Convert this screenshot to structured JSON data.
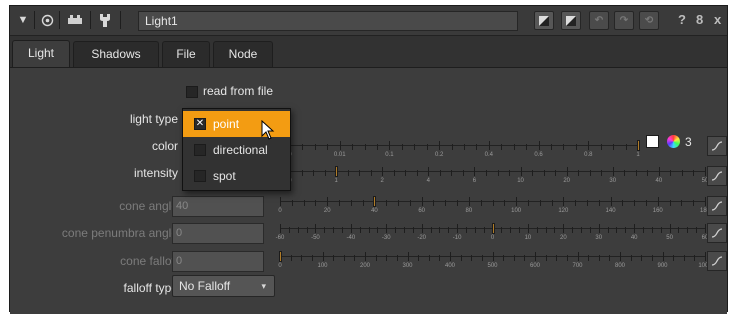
{
  "window": {
    "node_name": "Light1",
    "right_glyphs": [
      "?",
      "8",
      "x"
    ]
  },
  "tabs": [
    {
      "label": "Light",
      "active": true
    },
    {
      "label": "Shadows",
      "active": false
    },
    {
      "label": "File",
      "active": false
    },
    {
      "label": "Node",
      "active": false
    }
  ],
  "read_from_file": {
    "label": "read from file",
    "checked": false
  },
  "light_type": {
    "label": "light type",
    "options": [
      "point",
      "directional",
      "spot"
    ],
    "highlighted": "point"
  },
  "color": {
    "label": "color",
    "channel_count": "3",
    "ticks": [
      "0",
      "0.01",
      "0.1",
      "0.2",
      "0.4",
      "0.6",
      "0.8",
      "1"
    ]
  },
  "intensity": {
    "label": "intensity",
    "ticks": [
      "0",
      "1",
      "2",
      "4",
      "6",
      "10",
      "20",
      "30",
      "40",
      "50"
    ]
  },
  "cone_angle": {
    "label": "cone angle",
    "value": "40",
    "ticks": [
      "0",
      "20",
      "40",
      "60",
      "80",
      "100",
      "120",
      "140",
      "160",
      "180"
    ]
  },
  "cone_penumbra_angle": {
    "label": "cone penumbra angle",
    "value": "0",
    "ticks": [
      "-60",
      "-50",
      "-40",
      "-30",
      "-20",
      "-10",
      "0",
      "10",
      "20",
      "30",
      "40",
      "50",
      "60"
    ]
  },
  "cone_falloff": {
    "label": "cone falloff",
    "value": "0",
    "ticks": [
      "0",
      "100",
      "200",
      "300",
      "400",
      "500",
      "600",
      "700",
      "800",
      "900",
      "1000"
    ]
  },
  "falloff_type": {
    "label": "falloff type",
    "value": "No Falloff"
  },
  "colors": {
    "accent": "#f39c12",
    "panel": "#3d3d3d",
    "handle": "#b07c28"
  }
}
